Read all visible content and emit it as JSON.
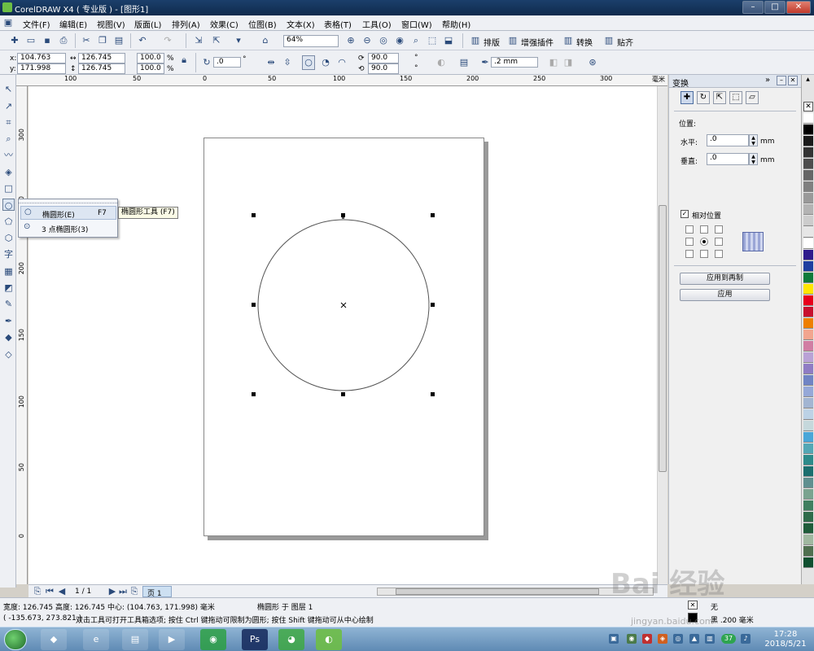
{
  "window": {
    "title": "CorelDRAW X4 ( 专业版 ) - [图形1]",
    "minimize": "–",
    "maximize": "□",
    "close": "✕"
  },
  "menu": [
    "文件(F)",
    "编辑(E)",
    "视图(V)",
    "版面(L)",
    "排列(A)",
    "效果(C)",
    "位图(B)",
    "文本(X)",
    "表格(T)",
    "工具(O)",
    "窗口(W)",
    "帮助(H)"
  ],
  "toolbar": {
    "zoom": "64%",
    "layout_label": "排版",
    "plugin_label": "增强插件",
    "convert_label": "转换",
    "paste_label": "贴齐"
  },
  "property_bar": {
    "x_label": "x:",
    "x_value": "104.763 mm",
    "y_label": "y:",
    "y_value": "171.998 mm",
    "width_value": "126.745 mm",
    "height_value": "126.745 mm",
    "scale_x": "100.0",
    "scale_y": "100.0",
    "percent": "%",
    "rotation": ".0",
    "deg": "°",
    "start_angle": "90.0",
    "end_angle": "90.0",
    "outline_width": ".2 mm"
  },
  "ruler": {
    "top_labels": [
      "100",
      "50",
      "0",
      "50",
      "100",
      "150",
      "200",
      "250",
      "300",
      "毫米"
    ],
    "left_labels": [
      "300",
      "250",
      "200",
      "150",
      "100",
      "50",
      "0"
    ]
  },
  "flyout": {
    "item1_label": "椭圆形(E)",
    "item1_shortcut": "F7",
    "item2_label": "3 点椭圆形(3)",
    "tooltip": "椭圆形工具 (F7)"
  },
  "docker": {
    "title": "变换",
    "position_label": "位置:",
    "horizontal_label": "水平:",
    "horizontal_value": ".0",
    "vertical_label": "垂直:",
    "vertical_value": ".0",
    "unit": "mm",
    "relative_label": "相对位置",
    "apply_copy_label": "应用到再制",
    "apply_label": "应用"
  },
  "page_nav": {
    "counter": "1 / 1",
    "page_tab": "页 1"
  },
  "status": {
    "line1": "宽度: 126.745  高度: 126.745  中心: (104.763, 171.998)  毫米",
    "layer": "椭圆形 于 图层 1",
    "coords": "( -135.673, 273.821 )",
    "hint": "双击工具可打开工具箱选项; 按住 Ctrl 键拖动可限制为圆形; 按住 Shift 键拖动可从中心绘制",
    "fill_label": "无",
    "outline_label": "黑 .200 毫米"
  },
  "taskbar": {
    "time": "17:28",
    "date": "2018/5/21",
    "badge": "37"
  },
  "watermark": {
    "logo": "Bai 经验",
    "url": "jingyan.baidu.com"
  },
  "palette": [
    "#ffffff",
    "#000000",
    "#1a1a1a",
    "#333333",
    "#4d4d4d",
    "#666666",
    "#808080",
    "#999999",
    "#b3b3b3",
    "#cccccc",
    "#e6e6e6",
    "#ffffff",
    "#2e1b8c",
    "#1e3fa0",
    "#0f7a3a",
    "#ffe600",
    "#e8001c",
    "#c8102e",
    "#ee7f00",
    "#f2a58f",
    "#d17ea3",
    "#b9a2d6",
    "#8f7cc4",
    "#7084c4",
    "#95a8d8",
    "#a2b5d2",
    "#bcd2e6",
    "#c5d8dc",
    "#4aa6d8",
    "#53a7b5",
    "#2c8a8a",
    "#1b6e6e",
    "#5f8f8f",
    "#7aa38f",
    "#3f7f5f",
    "#2e6b4a",
    "#1f5c3a",
    "#a0b8a0",
    "#4f6f4f",
    "#0f4f2f"
  ]
}
